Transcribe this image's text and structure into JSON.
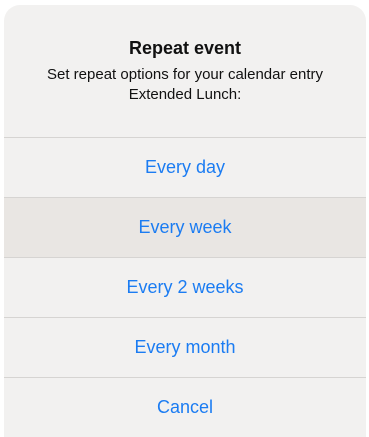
{
  "dialog": {
    "title": "Repeat event",
    "message": "Set repeat options for your calendar entry Extended Lunch:"
  },
  "options": [
    {
      "label": "Every day"
    },
    {
      "label": "Every week"
    },
    {
      "label": "Every 2 weeks"
    },
    {
      "label": "Every month"
    }
  ],
  "cancel": {
    "label": "Cancel"
  },
  "colors": {
    "accent": "#1b7cf2",
    "sheet_background": "#f2f1f0",
    "highlight_row": "#e9e6e3",
    "separator": "#d6d4d2"
  }
}
